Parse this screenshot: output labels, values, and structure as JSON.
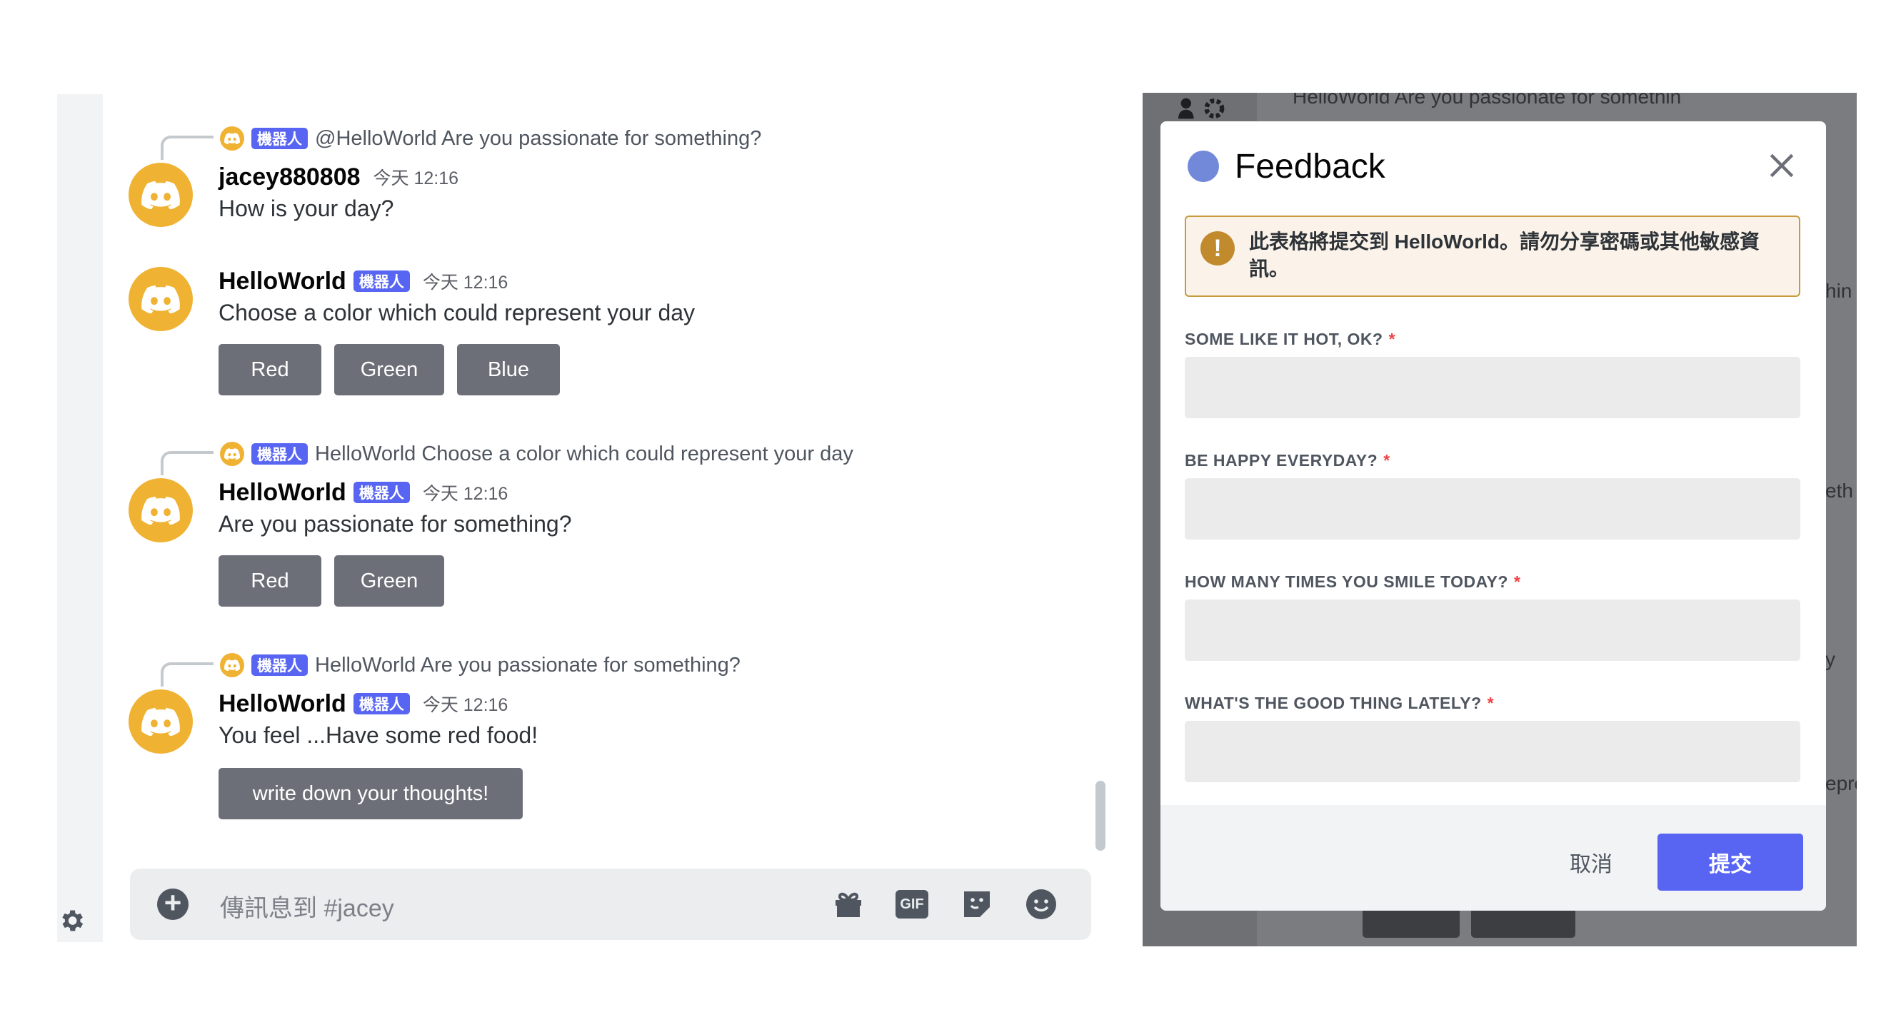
{
  "chat": {
    "messages": [
      {
        "reply": {
          "badge": "機器人",
          "text": "@HelloWorld Are you passionate for something?"
        },
        "username": "jacey880808",
        "time": "今天 12:16",
        "content": "How is your day?"
      },
      {
        "username": "HelloWorld",
        "badge": "機器人",
        "time": "今天 12:16",
        "content": "Choose a color which could represent your day",
        "buttons": [
          "Red",
          "Green",
          "Blue"
        ]
      },
      {
        "reply": {
          "badge": "機器人",
          "text": "HelloWorld Choose a color which could represent your day"
        },
        "username": "HelloWorld",
        "badge": "機器人",
        "time": "今天 12:16",
        "content": "Are you passionate for something?",
        "buttons": [
          "Red",
          "Green"
        ]
      },
      {
        "reply": {
          "badge": "機器人",
          "text": "HelloWorld Are you passionate for something?"
        },
        "username": "HelloWorld",
        "badge": "機器人",
        "time": "今天 12:16",
        "content": "You feel ...Have some red food!",
        "buttons": [
          "write down your thoughts!"
        ]
      }
    ],
    "input": {
      "placeholder": "傳訊息到 #jacey",
      "icons": [
        "add-attachment-icon",
        "gift-icon",
        "gif-icon",
        "sticker-icon",
        "emoji-icon"
      ],
      "gif_label": "GIF"
    }
  },
  "background": {
    "reply_text": "HelloWorld Are you passionate for somethin",
    "fragments": [
      "hin",
      "eth",
      "y",
      "epre"
    ]
  },
  "modal": {
    "title": "Feedback",
    "warning": "此表格將提交到 HelloWorld。請勿分享密碼或其他敏感資訊。",
    "fields": [
      {
        "label": "SOME LIKE IT HOT, OK?",
        "required": "*",
        "value": ""
      },
      {
        "label": "BE HAPPY EVERYDAY?",
        "required": "*",
        "value": ""
      },
      {
        "label": "HOW MANY TIMES YOU SMILE TODAY?",
        "required": "*",
        "value": ""
      },
      {
        "label": "WHAT'S THE GOOD THING LATELY?",
        "required": "*",
        "value": ""
      }
    ],
    "cancel_label": "取消",
    "submit_label": "提交"
  },
  "colors": {
    "blurple": "#5865f2",
    "avatar": "#f0b232",
    "component_button": "#6d6f78",
    "required": "#ed4245",
    "warning_border": "#c79a3c"
  }
}
